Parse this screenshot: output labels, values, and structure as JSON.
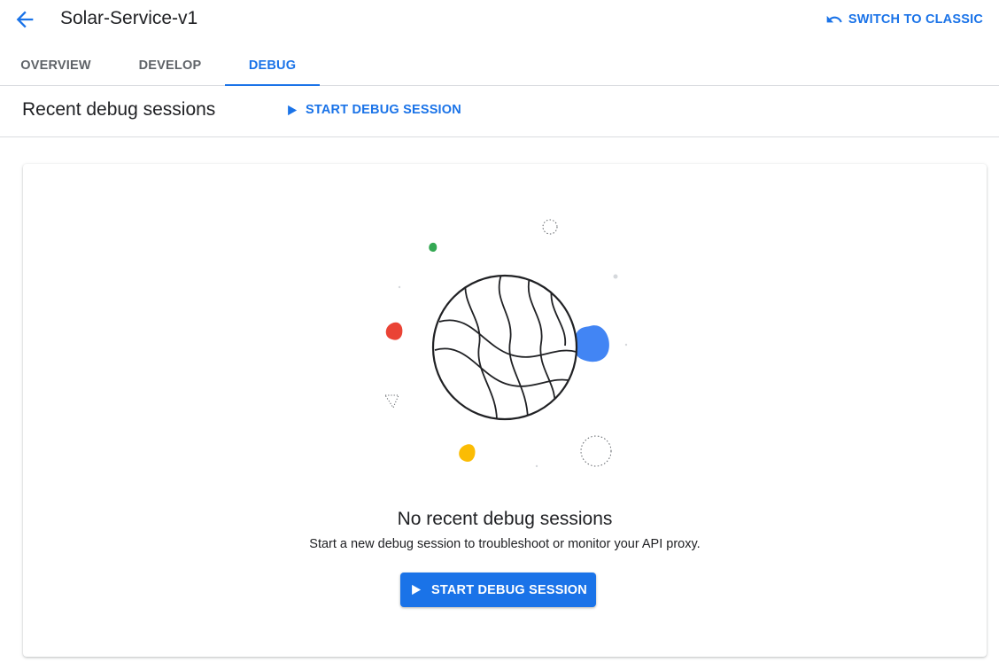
{
  "header": {
    "title": "Solar-Service-v1",
    "switch_label": "SWITCH TO CLASSIC"
  },
  "tabs": [
    {
      "label": "OVERVIEW",
      "active": false
    },
    {
      "label": "DEVELOP",
      "active": false
    },
    {
      "label": "DEBUG",
      "active": true
    }
  ],
  "section": {
    "title": "Recent debug sessions",
    "start_label": "START DEBUG SESSION"
  },
  "empty_state": {
    "title": "No recent debug sessions",
    "description": "Start a new debug session to troubleshoot or monitor your API proxy.",
    "button_label": "START DEBUG SESSION"
  },
  "icons": {
    "back": "arrow-back-icon",
    "switch": "undo-icon",
    "play": "play-icon",
    "illustration": "globe-illustration"
  },
  "colors": {
    "accent": "#1a73e8",
    "blob_blue": "#4285f4",
    "blob_red": "#ea4335",
    "blob_yellow": "#fbbc04",
    "blob_green": "#34a853"
  }
}
